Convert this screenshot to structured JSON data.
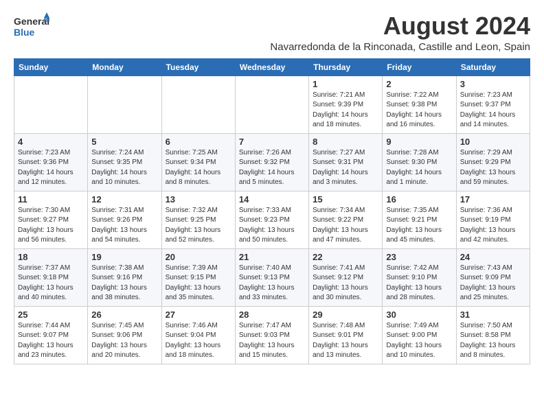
{
  "header": {
    "logo_general": "General",
    "logo_blue": "Blue",
    "main_title": "August 2024",
    "subtitle": "Navarredonda de la Rinconada, Castille and Leon, Spain"
  },
  "weekdays": [
    "Sunday",
    "Monday",
    "Tuesday",
    "Wednesday",
    "Thursday",
    "Friday",
    "Saturday"
  ],
  "weeks": [
    [
      {
        "num": "",
        "info": ""
      },
      {
        "num": "",
        "info": ""
      },
      {
        "num": "",
        "info": ""
      },
      {
        "num": "",
        "info": ""
      },
      {
        "num": "1",
        "info": "Sunrise: 7:21 AM\nSunset: 9:39 PM\nDaylight: 14 hours\nand 18 minutes."
      },
      {
        "num": "2",
        "info": "Sunrise: 7:22 AM\nSunset: 9:38 PM\nDaylight: 14 hours\nand 16 minutes."
      },
      {
        "num": "3",
        "info": "Sunrise: 7:23 AM\nSunset: 9:37 PM\nDaylight: 14 hours\nand 14 minutes."
      }
    ],
    [
      {
        "num": "4",
        "info": "Sunrise: 7:23 AM\nSunset: 9:36 PM\nDaylight: 14 hours\nand 12 minutes."
      },
      {
        "num": "5",
        "info": "Sunrise: 7:24 AM\nSunset: 9:35 PM\nDaylight: 14 hours\nand 10 minutes."
      },
      {
        "num": "6",
        "info": "Sunrise: 7:25 AM\nSunset: 9:34 PM\nDaylight: 14 hours\nand 8 minutes."
      },
      {
        "num": "7",
        "info": "Sunrise: 7:26 AM\nSunset: 9:32 PM\nDaylight: 14 hours\nand 5 minutes."
      },
      {
        "num": "8",
        "info": "Sunrise: 7:27 AM\nSunset: 9:31 PM\nDaylight: 14 hours\nand 3 minutes."
      },
      {
        "num": "9",
        "info": "Sunrise: 7:28 AM\nSunset: 9:30 PM\nDaylight: 14 hours\nand 1 minute."
      },
      {
        "num": "10",
        "info": "Sunrise: 7:29 AM\nSunset: 9:29 PM\nDaylight: 13 hours\nand 59 minutes."
      }
    ],
    [
      {
        "num": "11",
        "info": "Sunrise: 7:30 AM\nSunset: 9:27 PM\nDaylight: 13 hours\nand 56 minutes."
      },
      {
        "num": "12",
        "info": "Sunrise: 7:31 AM\nSunset: 9:26 PM\nDaylight: 13 hours\nand 54 minutes."
      },
      {
        "num": "13",
        "info": "Sunrise: 7:32 AM\nSunset: 9:25 PM\nDaylight: 13 hours\nand 52 minutes."
      },
      {
        "num": "14",
        "info": "Sunrise: 7:33 AM\nSunset: 9:23 PM\nDaylight: 13 hours\nand 50 minutes."
      },
      {
        "num": "15",
        "info": "Sunrise: 7:34 AM\nSunset: 9:22 PM\nDaylight: 13 hours\nand 47 minutes."
      },
      {
        "num": "16",
        "info": "Sunrise: 7:35 AM\nSunset: 9:21 PM\nDaylight: 13 hours\nand 45 minutes."
      },
      {
        "num": "17",
        "info": "Sunrise: 7:36 AM\nSunset: 9:19 PM\nDaylight: 13 hours\nand 42 minutes."
      }
    ],
    [
      {
        "num": "18",
        "info": "Sunrise: 7:37 AM\nSunset: 9:18 PM\nDaylight: 13 hours\nand 40 minutes."
      },
      {
        "num": "19",
        "info": "Sunrise: 7:38 AM\nSunset: 9:16 PM\nDaylight: 13 hours\nand 38 minutes."
      },
      {
        "num": "20",
        "info": "Sunrise: 7:39 AM\nSunset: 9:15 PM\nDaylight: 13 hours\nand 35 minutes."
      },
      {
        "num": "21",
        "info": "Sunrise: 7:40 AM\nSunset: 9:13 PM\nDaylight: 13 hours\nand 33 minutes."
      },
      {
        "num": "22",
        "info": "Sunrise: 7:41 AM\nSunset: 9:12 PM\nDaylight: 13 hours\nand 30 minutes."
      },
      {
        "num": "23",
        "info": "Sunrise: 7:42 AM\nSunset: 9:10 PM\nDaylight: 13 hours\nand 28 minutes."
      },
      {
        "num": "24",
        "info": "Sunrise: 7:43 AM\nSunset: 9:09 PM\nDaylight: 13 hours\nand 25 minutes."
      }
    ],
    [
      {
        "num": "25",
        "info": "Sunrise: 7:44 AM\nSunset: 9:07 PM\nDaylight: 13 hours\nand 23 minutes."
      },
      {
        "num": "26",
        "info": "Sunrise: 7:45 AM\nSunset: 9:06 PM\nDaylight: 13 hours\nand 20 minutes."
      },
      {
        "num": "27",
        "info": "Sunrise: 7:46 AM\nSunset: 9:04 PM\nDaylight: 13 hours\nand 18 minutes."
      },
      {
        "num": "28",
        "info": "Sunrise: 7:47 AM\nSunset: 9:03 PM\nDaylight: 13 hours\nand 15 minutes."
      },
      {
        "num": "29",
        "info": "Sunrise: 7:48 AM\nSunset: 9:01 PM\nDaylight: 13 hours\nand 13 minutes."
      },
      {
        "num": "30",
        "info": "Sunrise: 7:49 AM\nSunset: 9:00 PM\nDaylight: 13 hours\nand 10 minutes."
      },
      {
        "num": "31",
        "info": "Sunrise: 7:50 AM\nSunset: 8:58 PM\nDaylight: 13 hours\nand 8 minutes."
      }
    ]
  ]
}
